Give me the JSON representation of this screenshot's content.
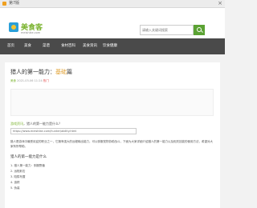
{
  "window": {
    "title": "第7版"
  },
  "header": {
    "logo_text": "美食客",
    "logo_sub": "meishike.com",
    "search": {
      "placeholder": "请输入关键词搜索"
    }
  },
  "nav": {
    "items": [
      "首页",
      "美食",
      "菜谱",
      "食材百科",
      "美食资讯",
      "饮食健康"
    ]
  },
  "article": {
    "title_prefix": "猎人的第一能力：",
    "title_highlight": "基础",
    "title_suffix": "篇",
    "meta_tag": "美食",
    "meta_date": "2021-03-06 11:24",
    "meta_hot": "热门",
    "section_label_green": "游戏资讯",
    "section_label_rest": "，猎人的第一能力是什么？",
    "url_value": "https://www.meishike.com/hunter/ability.html",
    "body": "猎人是游戏中最受欢迎的职业之一，它拥有强大的远程输出能力，可以驯服宠物协助战斗，下面为大家详细介绍猎人的第一能力以及相关技能的使用方法，希望对大家有所帮助。",
    "sub_heading": "猎人的第一能力是什么",
    "abilities": [
      "1. 猎人第一能力：驯服野兽",
      "2. 远程射击",
      "3. 陷阱布置",
      "4. 追踪",
      "5. 伪装"
    ]
  }
}
